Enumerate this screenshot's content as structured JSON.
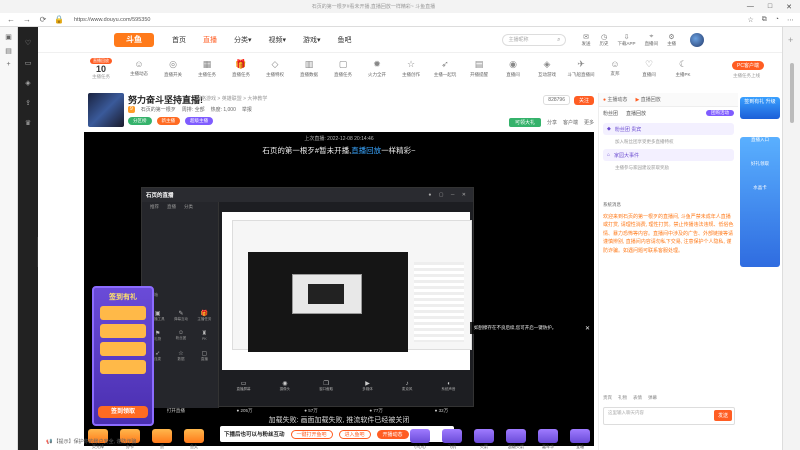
{
  "window": {
    "title": "石页的第一根歹#看未开播,直播回放一样精彩~ 斗鱼直播",
    "url": "https://www.douyu.com/595350",
    "minimize": "—",
    "maximize": "□",
    "close": "✕"
  },
  "header": {
    "logo": "斗鱼",
    "nav": [
      "首页",
      "直播",
      "分类▾",
      "视频▾",
      "游戏▾",
      "鱼吧"
    ],
    "active_nav": "直播",
    "search_placeholder": "主播昵称",
    "icons": [
      {
        "icon": "mail-icon",
        "label": "发送"
      },
      {
        "icon": "clock-icon",
        "label": "历史"
      },
      {
        "icon": "download-icon",
        "label": "下载APP"
      },
      {
        "icon": "pin-icon",
        "label": "直播间"
      },
      {
        "icon": "settings-icon",
        "label": "主播"
      }
    ]
  },
  "category_bar": {
    "task_badge": "直播回放",
    "task_number": "10",
    "task_label": "主播任务",
    "items": [
      {
        "icon": "people-icon",
        "label": "主播动态"
      },
      {
        "icon": "glasses-icon",
        "label": "直播开关"
      },
      {
        "icon": "grid-icon",
        "label": "主播任务"
      },
      {
        "icon": "gift-icon",
        "label": "直播任务"
      },
      {
        "icon": "diamond-icon",
        "label": "主播特权"
      },
      {
        "icon": "chart-icon",
        "label": "直播数据"
      },
      {
        "icon": "box-icon",
        "label": "直播任务"
      },
      {
        "icon": "fire-icon",
        "label": "火力全开"
      },
      {
        "icon": "star-icon",
        "label": "主播创作"
      },
      {
        "icon": "rocket-icon",
        "label": "主播一起玩"
      },
      {
        "icon": "cards-icon",
        "label": "开播提醒"
      },
      {
        "icon": "camera-icon",
        "label": "直播间"
      },
      {
        "icon": "game-icon",
        "label": "互动游戏"
      },
      {
        "icon": "plane-icon",
        "label": "斗飞船直播间"
      },
      {
        "icon": "people-icon",
        "label": "友邦"
      },
      {
        "icon": "heart-icon",
        "label": "直播间"
      },
      {
        "icon": "moon-icon",
        "label": "主播PK"
      },
      {
        "icon": "controller-icon",
        "label": "互动游戏"
      },
      {
        "icon": "trophy-icon",
        "label": "荣誉殿堂"
      },
      {
        "icon": "more-icon",
        "label": "更多"
      }
    ],
    "pc_button": "PC客户端",
    "pc_sub": "主播任务上线"
  },
  "room": {
    "title": "努力奋斗坚持直播!",
    "category": "网络游戏 > 英雄联盟 > 大神教学",
    "level": "9",
    "meta_host": "石页的第一根歹",
    "meta_rank": "周排: 全部",
    "meta_hot": "热度: 1,000",
    "meta_report": "举报",
    "tags": [
      "分区榜",
      "新主播",
      "超级主播"
    ],
    "tag_colors": [
      "#35b26b",
      "#ff6b22",
      "#7f5cff"
    ],
    "count": "828796",
    "follow": "关注",
    "gift_btn": "可领大礼",
    "actions": [
      "分享",
      "客户端",
      "更多"
    ]
  },
  "player": {
    "top_info": "上次直播: 2022-12-08 20:14:46",
    "message": "石页的第一根歹#暂未开播,",
    "message_hl": "直播回放",
    "message_tail": "一样精彩~",
    "inner_logo": "石页的直播",
    "inner_tabs": [
      "推荐",
      "直播",
      "分类"
    ],
    "inner_left_title": "工具箱",
    "inner_tools": [
      {
        "icon": "cube-icon",
        "label": "直播工具"
      },
      {
        "icon": "chat-icon",
        "label": "弹幕互动"
      },
      {
        "icon": "gift-icon",
        "label": "主播任务"
      },
      {
        "icon": "flag-icon",
        "label": "礼物"
      },
      {
        "icon": "people-icon",
        "label": "粉丝团"
      },
      {
        "icon": "trophy-icon",
        "label": "PK"
      },
      {
        "icon": "rocket-icon",
        "label": "连麦"
      },
      {
        "icon": "star-icon",
        "label": "数据"
      },
      {
        "icon": "box-icon",
        "label": "直播"
      }
    ],
    "inner_bottom": [
      {
        "icon": "screen-icon",
        "label": "直播屏幕"
      },
      {
        "icon": "camera-icon",
        "label": "摄像头"
      },
      {
        "icon": "window-icon",
        "label": "窗口截取"
      },
      {
        "icon": "media-icon",
        "label": "多媒体"
      },
      {
        "icon": "mic-icon",
        "label": "麦克风"
      },
      {
        "icon": "volume-icon",
        "label": "系统声音"
      }
    ],
    "inner_stats": [
      "打开直播",
      "● 205万",
      "● 57万",
      "● 77万",
      "● 32万"
    ],
    "tip": "如刮擦存在不良后续,您可开启一键防护。",
    "error": "加载失败: 画面加载失败, 推流软件已经被关闭",
    "banner_text": "下播后也可以与粉丝互动",
    "banner_btn1": "一键打开鱼吧",
    "banner_btn2": "进入鱼吧",
    "banner_btn3": "开播动态",
    "signin_title": "签到有礼",
    "signin_btn": "签到领取"
  },
  "rpanel": {
    "head": [
      "主播动态",
      "直播回放"
    ],
    "tabs": [
      "粉丝团",
      "直播回放"
    ],
    "tab_pill": "团购活动",
    "item1": "粉丝团 贵宾",
    "item1_sub": "加入粉丝团享受更多直播特权",
    "item2": "家园大事件",
    "item2_sub": "主播参与家园建设获取奖励",
    "chat_who": "系统消息",
    "chat_text": "欢迎来到石页的第一根歹的直播间, 斗鱼严禁未成年人直播或打赏, 请理性消费, 理性打赏。禁止传播违法违规、低俗色情、暴力恐怖等内容。直播间中涉及的广告、外部链接等请谨慎辨别, 直播间内容请勿私下交易, 注意保护个人隐私, 谨防诈骗。如遇问题可联系客服处理。",
    "bottom_items": [
      "贵宾",
      "礼物",
      "表情",
      "弹幕"
    ],
    "input_placeholder": "这里输入聊天内容",
    "send": "发送"
  },
  "promo": {
    "top": "签到有礼 升级",
    "items": [
      "直播入口",
      "好礼领取",
      "水晶卡"
    ]
  },
  "giftbar": {
    "items": [
      "荧光棒",
      "办卡",
      "赞",
      "鱼丸",
      "小心心",
      "飞机",
      "火箭",
      "超级火箭",
      "嘉年华",
      "宝箱"
    ],
    "purple_from": 4
  },
  "chatline": "📢 【提示】保护你的账户安全, 谨防诈骗"
}
